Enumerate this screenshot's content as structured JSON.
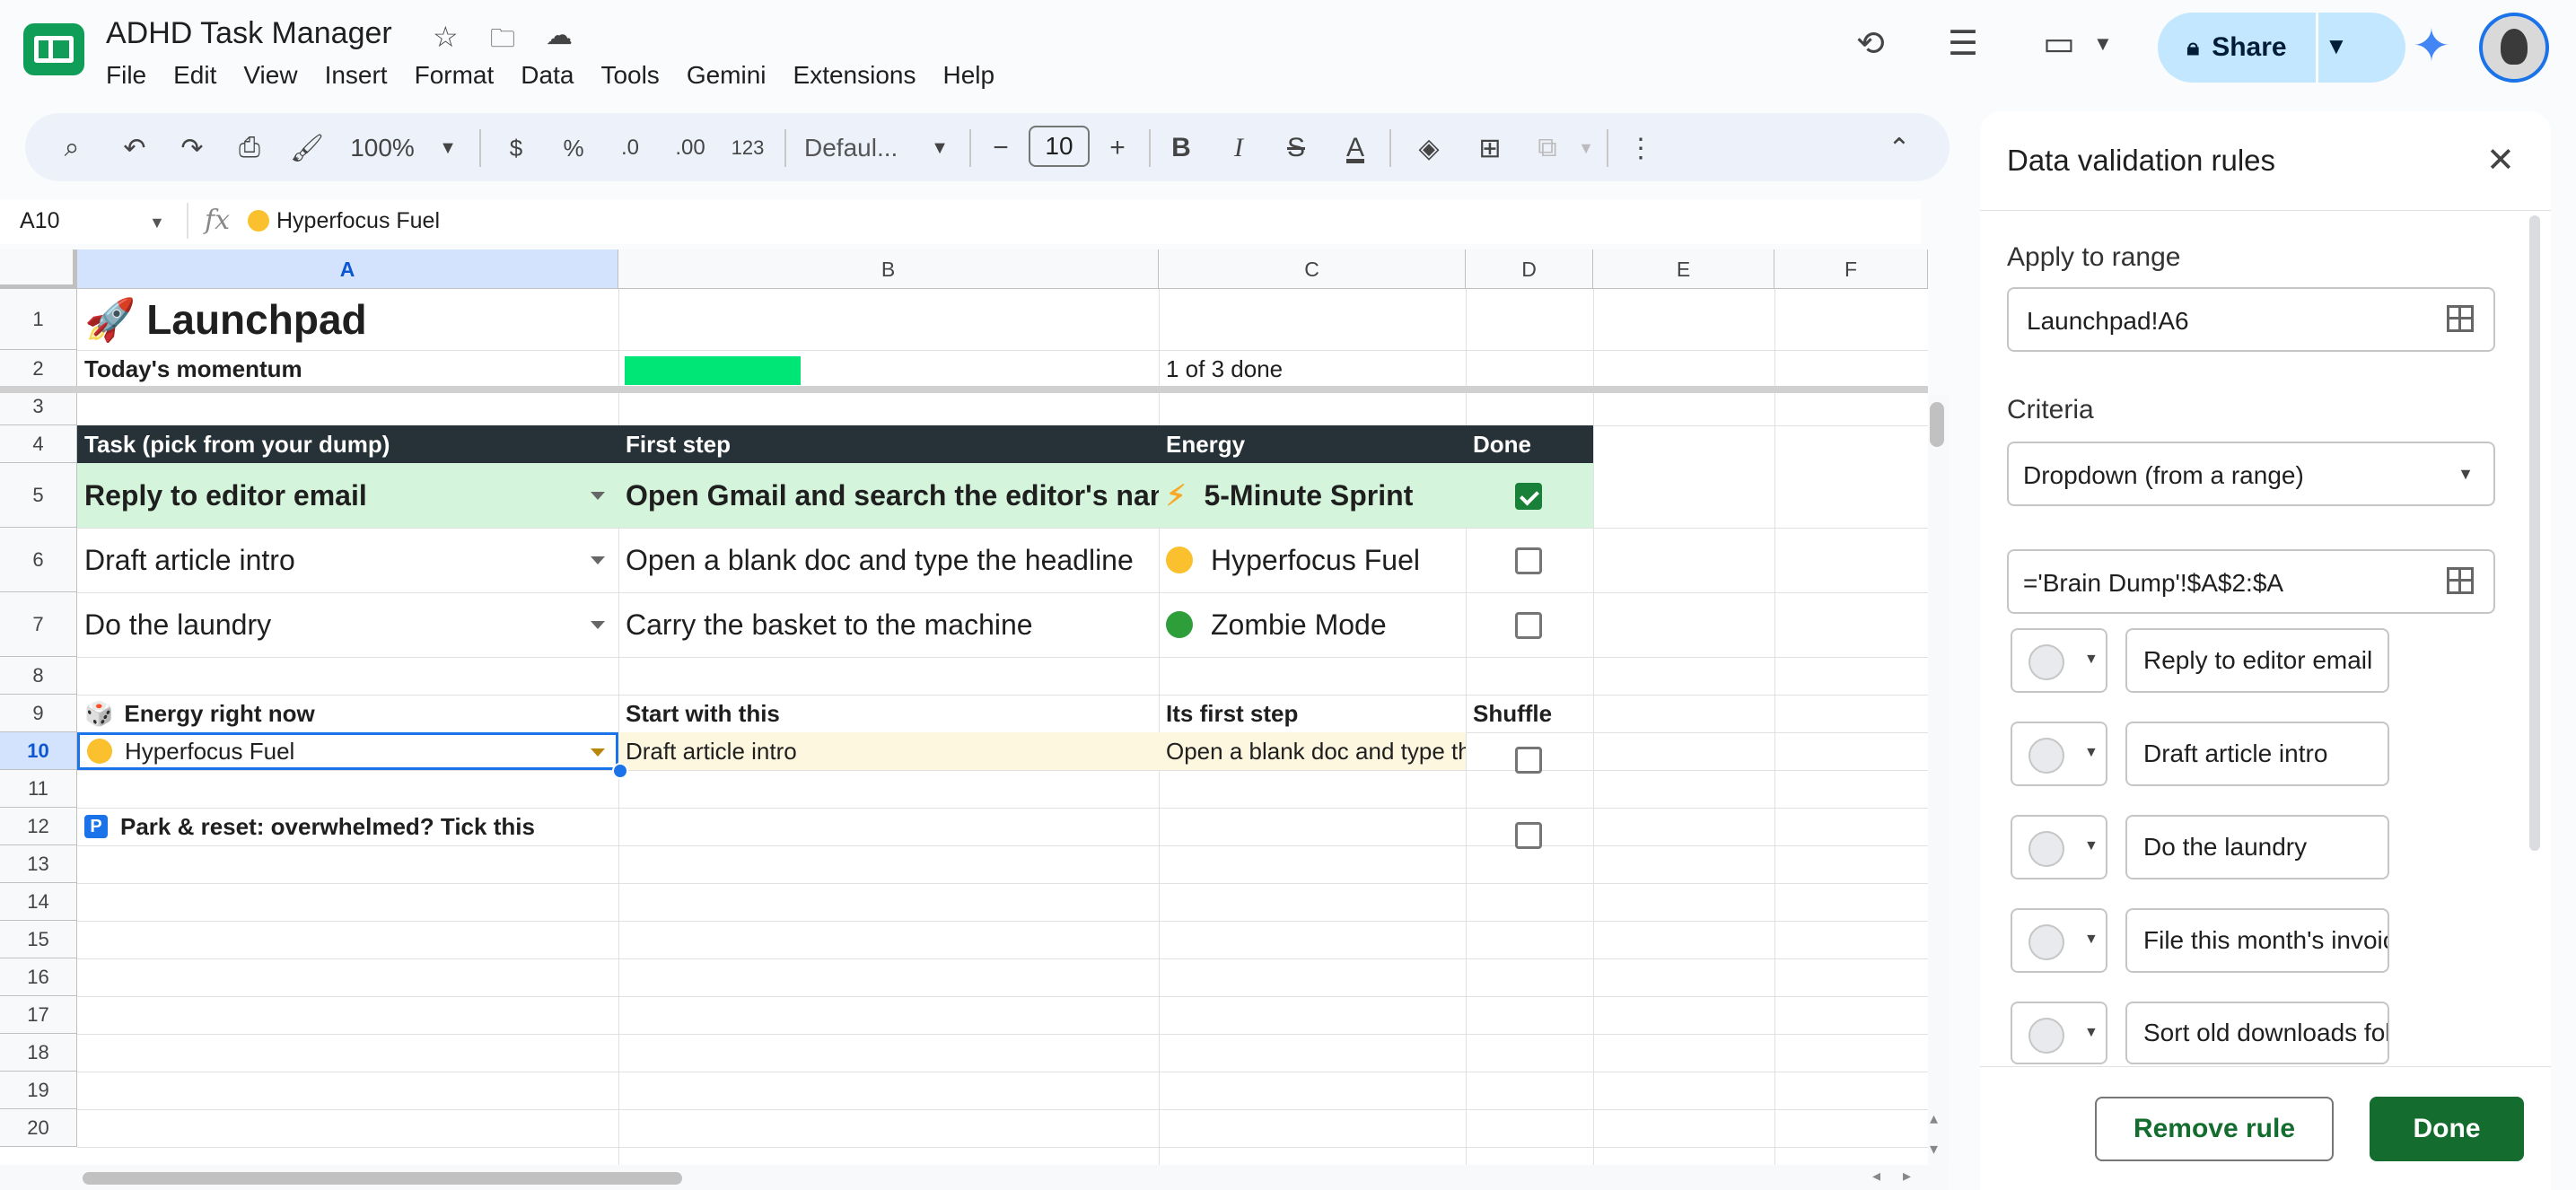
{
  "app": {
    "title": "ADHD Task Manager",
    "menu": [
      "File",
      "Edit",
      "View",
      "Insert",
      "Format",
      "Data",
      "Tools",
      "Gemini",
      "Extensions",
      "Help"
    ],
    "share_label": "Share"
  },
  "toolbar": {
    "zoom": "100%",
    "currency": "$",
    "percent": "%",
    "dec_minus": ".0",
    "dec_plus": ".00",
    "format_123": "123",
    "font": "Defaul...",
    "font_size": "10"
  },
  "formula_bar": {
    "cell_ref": "A10",
    "fx": "fx",
    "value": "Hyperfocus Fuel"
  },
  "sheet": {
    "columns": [
      "A",
      "B",
      "C",
      "D",
      "E",
      "F"
    ],
    "rows": [
      "1",
      "2",
      "3",
      "4",
      "5",
      "6",
      "7",
      "8",
      "9",
      "10",
      "11",
      "12",
      "13",
      "14",
      "15",
      "16",
      "17",
      "18",
      "19",
      "20"
    ],
    "launchpad": "Launchpad",
    "momentum_label": "Today's momentum",
    "momentum_progress": 0.333,
    "momentum_text": "1 of 3 done",
    "headers": [
      "Task (pick from your dump)",
      "First step",
      "Energy",
      "Done"
    ],
    "tasks": [
      {
        "task": "Reply to editor email",
        "step": "Open Gmail and search the editor's name",
        "energy": "5-Minute Sprint",
        "energy_icon": "lightning",
        "done": true
      },
      {
        "task": "Draft article intro",
        "step": "Open a blank doc and type the headline",
        "energy": "Hyperfocus Fuel",
        "energy_icon": "yellow-dot",
        "done": false
      },
      {
        "task": "Do the laundry",
        "step": "Carry the basket to the machine",
        "energy": "Zombie Mode",
        "energy_icon": "green-dot",
        "done": false
      }
    ],
    "energy_header": "Energy right now",
    "start_header": "Start with this",
    "first_step_header": "Its first step",
    "shuffle_header": "Shuffle",
    "energy_value": "Hyperfocus Fuel",
    "start_value": "Draft article intro",
    "first_step_value": "Open a blank doc and type the headline",
    "park_label": "Park & reset: overwhelmed? Tick this"
  },
  "panel": {
    "title": "Data validation rules",
    "apply_label": "Apply to range",
    "apply_value": "Launchpad!A6",
    "criteria_label": "Criteria",
    "criteria_value": "Dropdown (from a range)",
    "range_value": "='Brain Dump'!$A$2:$A",
    "options": [
      "Reply to editor email",
      "Draft article intro",
      "Do the laundry",
      "File this month's invoices",
      "Sort old downloads folder"
    ],
    "remove_label": "Remove rule",
    "done_label": "Done"
  },
  "colors": {
    "selected_header": "#d3e3fd",
    "task_header_bg": "#263238",
    "sprint_row_bg": "#d4f5dc",
    "highlight_row_bg": "#fef7e0",
    "progress_fill": "#00e676",
    "done_button": "#146c2e",
    "share_button": "#c2e7ff"
  }
}
